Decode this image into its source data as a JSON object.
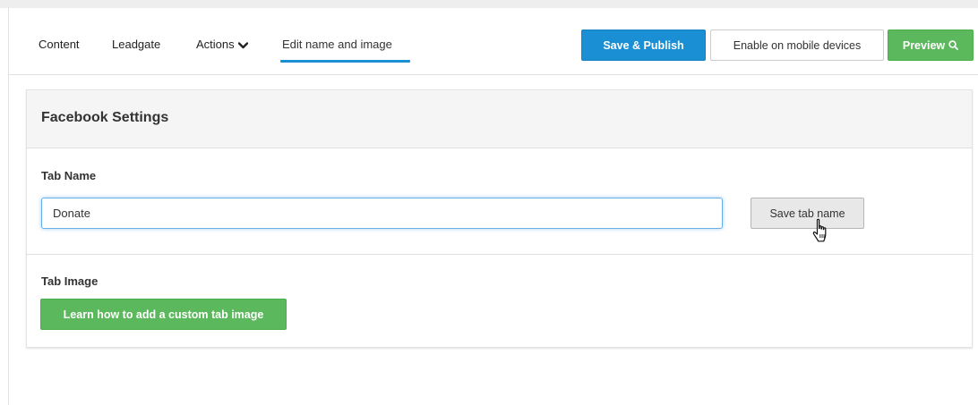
{
  "nav": {
    "content": "Content",
    "leadgate": "Leadgate",
    "actions": "Actions",
    "edit_name_image": "Edit name and image"
  },
  "toolbar": {
    "save_publish": "Save & Publish",
    "enable_mobile": "Enable on mobile devices",
    "preview": "Preview"
  },
  "panel": {
    "title": "Facebook Settings",
    "tab_name_label": "Tab Name",
    "tab_name_value": "Donate",
    "save_tab_name": "Save tab name",
    "tab_image_label": "Tab Image",
    "learn_button": "Learn how to add a custom tab image"
  },
  "colors": {
    "accent_blue": "#1a8fd3",
    "success_green": "#5cb85c",
    "panel_header_bg": "#f5f5f5"
  },
  "icons": {
    "actions_dropdown": "chevron-down-icon",
    "preview": "search-icon",
    "mouse_pointer": "hand-pointer-icon"
  }
}
